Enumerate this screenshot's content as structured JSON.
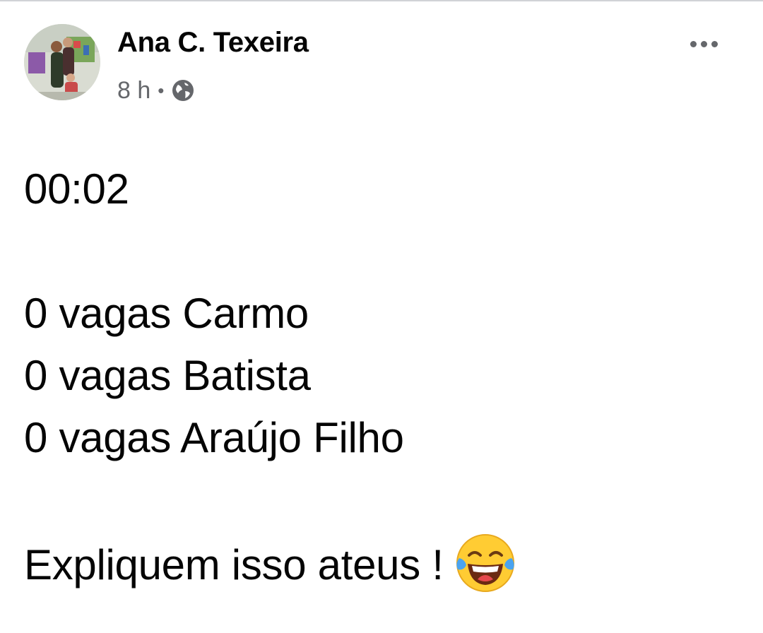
{
  "post": {
    "author_name": "Ana C. Texeira",
    "timestamp": "8 h",
    "separator": "•",
    "audience_icon": "globe-icon",
    "more_icon": "more-horizontal-icon",
    "body_lines": [
      "00:02",
      "",
      "0 vagas Carmo",
      "0 vagas Batista",
      "0 vagas Araújo Filho",
      "",
      "Expliquem isso ateus !"
    ],
    "trailing_emoji": "face-with-tears-of-joy-icon"
  },
  "colors": {
    "text": "#050505",
    "secondary": "#65676b",
    "emoji_face": "#ffcc33",
    "emoji_tears": "#4aa3f0"
  }
}
